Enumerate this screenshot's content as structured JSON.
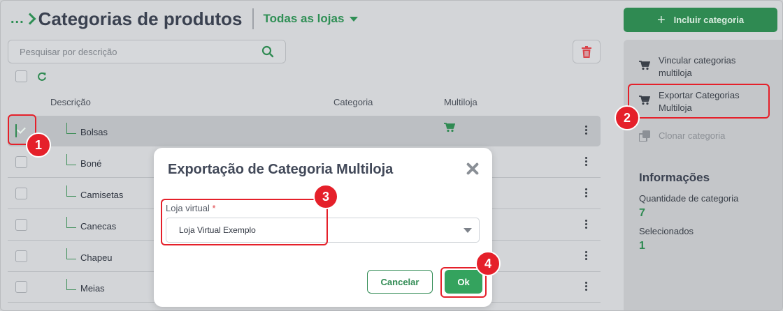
{
  "header": {
    "breadcrumb_dots": "...",
    "title": "Categorias de produtos",
    "store_select": "Todas as lojas"
  },
  "actions": {
    "include_label": "Incluir categoria"
  },
  "search": {
    "placeholder": "Pesquisar por descrição"
  },
  "table": {
    "columns": [
      "Descrição",
      "Categoria",
      "Multiloja"
    ],
    "rows": [
      {
        "name": "Bolsas",
        "checked": true,
        "multiloja": true
      },
      {
        "name": "Boné",
        "checked": false,
        "multiloja": false
      },
      {
        "name": "Camisetas",
        "checked": false,
        "multiloja": false
      },
      {
        "name": "Canecas",
        "checked": false,
        "multiloja": false
      },
      {
        "name": "Chapeu",
        "checked": false,
        "multiloja": false
      },
      {
        "name": "Meias",
        "checked": false,
        "multiloja": false
      }
    ]
  },
  "sidebar": {
    "items": [
      {
        "label_l1": "Vincular categorias",
        "label_l2": "multiloja",
        "icon": "cart-icon",
        "enabled": true
      },
      {
        "label_l1": "Exportar Categorias",
        "label_l2": "Multiloja",
        "icon": "cart-icon",
        "enabled": true
      },
      {
        "label_l1": "Clonar categoria",
        "label_l2": "",
        "icon": "clone-icon",
        "enabled": false
      }
    ],
    "info_title": "Informações",
    "quantity_label": "Quantidade de categoria",
    "quantity_value": "7",
    "selected_label": "Selecionados",
    "selected_value": "1"
  },
  "modal": {
    "title": "Exportação de Categoria Multiloja",
    "field_label": "Loja virtual",
    "required_mark": "*",
    "selected_store": "Loja Virtual Exemplo",
    "cancel_label": "Cancelar",
    "ok_label": "Ok"
  },
  "annotations": [
    "1",
    "2",
    "3",
    "4"
  ],
  "colors": {
    "brand_green": "#2f8a52",
    "ok_green": "#34a35e",
    "annotation_red": "#e5202a",
    "delete_red": "#e0474c"
  }
}
